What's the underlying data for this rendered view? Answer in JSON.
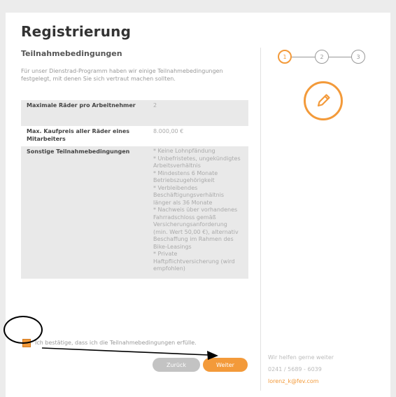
{
  "page": {
    "title": "Registrierung",
    "subtitle": "Teilnahmebedingungen",
    "intro": "Für unser Dienstrad-Programm haben wir einige Teilnahmebedingungen festgelegt, mit denen Sie sich vertraut machen sollten."
  },
  "conditions": {
    "rows": [
      {
        "label": "Maximale Räder pro Arbeitnehmer",
        "value": "2"
      },
      {
        "label": "Max. Kaufpreis aller Räder eines Mitarbeiters",
        "value": "8.000,00 €"
      }
    ],
    "other_label": "Sonstige Teilnahmebedingungen",
    "other_items": [
      "* Keine Lohnpfändung",
      "* Unbefristetes, ungekündigtes Arbeitsverhältnis",
      "* Mindestens 6 Monate Betriebszugehörigkeit",
      "* Verbleibendes Beschäftigungsverhältnis länger als 36 Monate",
      "* Nachweis über vorhandenes Fahrradschloss gemäß Versicherungsanforderung (min. Wert 50,00 €), alternativ Beschaffung im Rahmen des Bike-Leasings",
      "* Private Haftpflichtversicherung (wird empfohlen)"
    ]
  },
  "consent": {
    "label": "Ich bestätige, dass ich die Teilnahmebedingungen erfülle.",
    "checked": true
  },
  "buttons": {
    "back": "Zurück",
    "next": "Weiter"
  },
  "steps": [
    "1",
    "2",
    "3"
  ],
  "active_step": 1,
  "help": {
    "heading": "Wir helfen gerne weiter",
    "phone": "0241 / 5689 - 6039",
    "email": "lorenz_k@fev.com"
  },
  "icons": {
    "step_icon": "pencil-icon",
    "annotation": "arrow-annotation"
  },
  "colors": {
    "accent": "#f39a3a",
    "muted_button": "#c3c3c3",
    "table_shade": "#e9e9e9"
  }
}
